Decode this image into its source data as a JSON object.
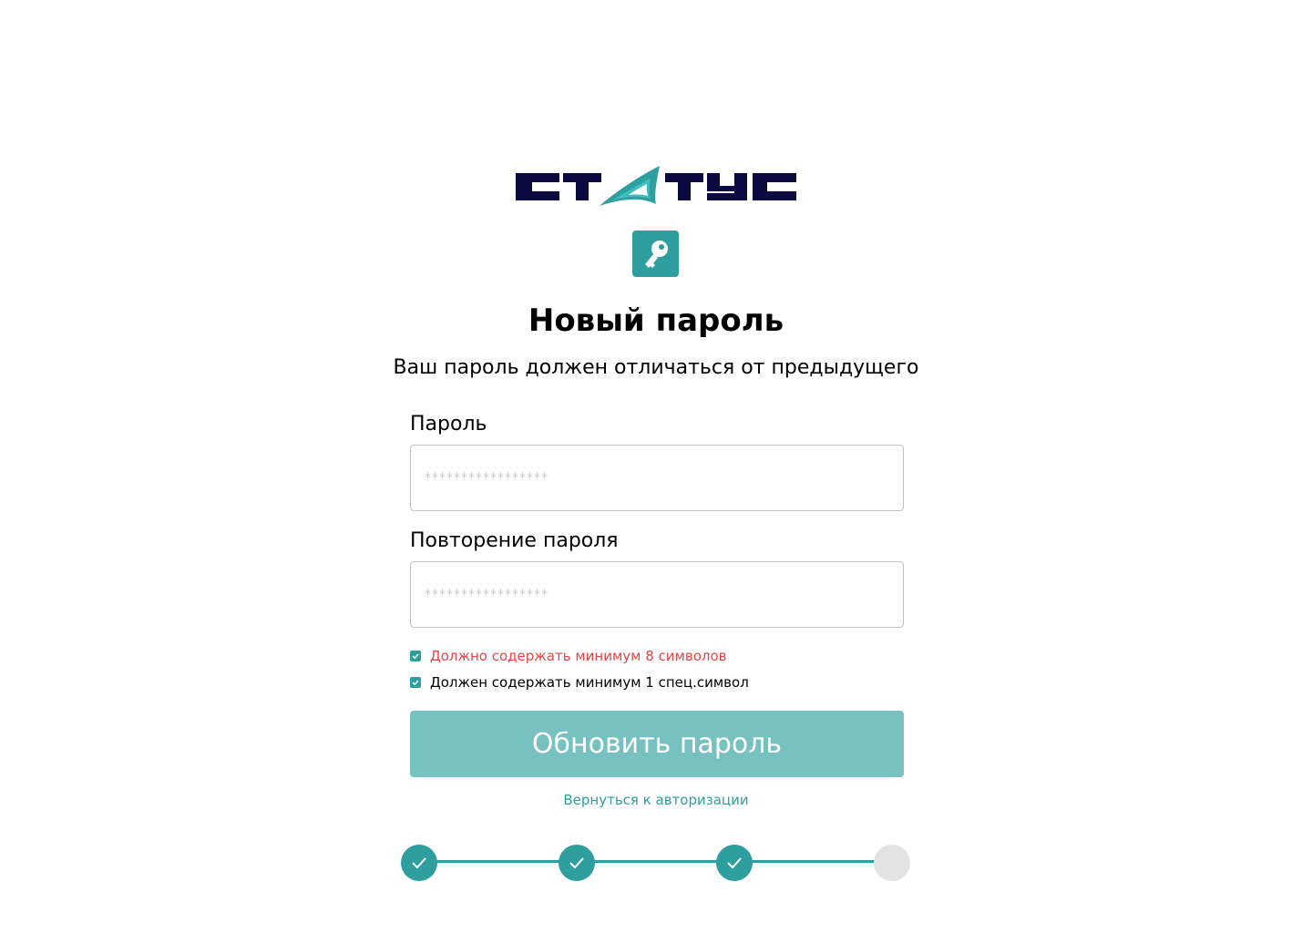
{
  "brand": {
    "logo_text": "СТАТУС",
    "colors": {
      "dark": "#0a0a40",
      "accent": "#2e9e9e",
      "accent_light": "#3dbdbd"
    }
  },
  "header": {
    "icon": "key-icon",
    "title": "Новый пароль",
    "subtitle": "Ваш пароль должен отличаться от предыдущего"
  },
  "form": {
    "password": {
      "label": "Пароль",
      "placeholder": "*****************",
      "value": ""
    },
    "password_repeat": {
      "label": "Повторение пароля",
      "placeholder": "*****************",
      "value": ""
    },
    "rules": [
      {
        "text": "Должно содержать минимум 8 символов",
        "checked": true,
        "status": "error",
        "color": "#e84646"
      },
      {
        "text": "Должен содержать минимум 1 спец.символ",
        "checked": true,
        "status": "ok",
        "color": "#000000"
      }
    ],
    "submit_label": "Обновить пароль",
    "back_link": "Вернуться к авторизации"
  },
  "stepper": {
    "steps": [
      {
        "status": "done",
        "icon": "check-icon"
      },
      {
        "status": "done",
        "icon": "check-icon"
      },
      {
        "status": "done",
        "icon": "check-icon"
      },
      {
        "status": "todo"
      }
    ],
    "colors": {
      "done": "#2e9e9e",
      "todo": "#e3e3e3"
    }
  }
}
